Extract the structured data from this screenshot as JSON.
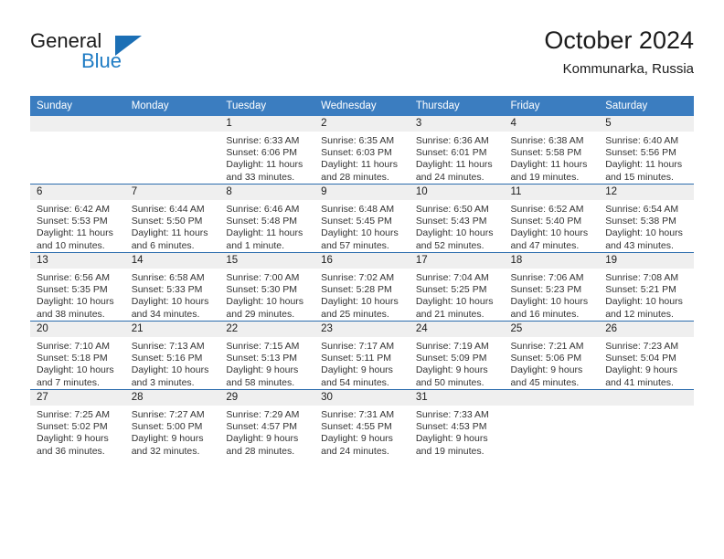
{
  "brand": {
    "name_top": "General",
    "name_bottom": "Blue",
    "triangle_color": "#1b6fb5",
    "blue_text_color": "#1f7cc4"
  },
  "header": {
    "title": "October 2024",
    "subtitle": "Kommunarka, Russia"
  },
  "colors": {
    "header_blue": "#3b7dc0",
    "row_divider": "#2b6cad",
    "daynum_band": "#efefef",
    "text": "#1b1b1b"
  },
  "calendar": {
    "weekday_headers": [
      "Sunday",
      "Monday",
      "Tuesday",
      "Wednesday",
      "Thursday",
      "Friday",
      "Saturday"
    ],
    "labels": {
      "sunrise": "Sunrise:",
      "sunset": "Sunset:",
      "daylight": "Daylight:"
    },
    "weeks": [
      [
        {
          "day": "",
          "empty": true
        },
        {
          "day": "",
          "empty": true
        },
        {
          "day": "1",
          "sunrise": "Sunrise: 6:33 AM",
          "sunset": "Sunset: 6:06 PM",
          "daylight": "Daylight: 11 hours and 33 minutes."
        },
        {
          "day": "2",
          "sunrise": "Sunrise: 6:35 AM",
          "sunset": "Sunset: 6:03 PM",
          "daylight": "Daylight: 11 hours and 28 minutes."
        },
        {
          "day": "3",
          "sunrise": "Sunrise: 6:36 AM",
          "sunset": "Sunset: 6:01 PM",
          "daylight": "Daylight: 11 hours and 24 minutes."
        },
        {
          "day": "4",
          "sunrise": "Sunrise: 6:38 AM",
          "sunset": "Sunset: 5:58 PM",
          "daylight": "Daylight: 11 hours and 19 minutes."
        },
        {
          "day": "5",
          "sunrise": "Sunrise: 6:40 AM",
          "sunset": "Sunset: 5:56 PM",
          "daylight": "Daylight: 11 hours and 15 minutes."
        }
      ],
      [
        {
          "day": "6",
          "sunrise": "Sunrise: 6:42 AM",
          "sunset": "Sunset: 5:53 PM",
          "daylight": "Daylight: 11 hours and 10 minutes."
        },
        {
          "day": "7",
          "sunrise": "Sunrise: 6:44 AM",
          "sunset": "Sunset: 5:50 PM",
          "daylight": "Daylight: 11 hours and 6 minutes."
        },
        {
          "day": "8",
          "sunrise": "Sunrise: 6:46 AM",
          "sunset": "Sunset: 5:48 PM",
          "daylight": "Daylight: 11 hours and 1 minute."
        },
        {
          "day": "9",
          "sunrise": "Sunrise: 6:48 AM",
          "sunset": "Sunset: 5:45 PM",
          "daylight": "Daylight: 10 hours and 57 minutes."
        },
        {
          "day": "10",
          "sunrise": "Sunrise: 6:50 AM",
          "sunset": "Sunset: 5:43 PM",
          "daylight": "Daylight: 10 hours and 52 minutes."
        },
        {
          "day": "11",
          "sunrise": "Sunrise: 6:52 AM",
          "sunset": "Sunset: 5:40 PM",
          "daylight": "Daylight: 10 hours and 47 minutes."
        },
        {
          "day": "12",
          "sunrise": "Sunrise: 6:54 AM",
          "sunset": "Sunset: 5:38 PM",
          "daylight": "Daylight: 10 hours and 43 minutes."
        }
      ],
      [
        {
          "day": "13",
          "sunrise": "Sunrise: 6:56 AM",
          "sunset": "Sunset: 5:35 PM",
          "daylight": "Daylight: 10 hours and 38 minutes."
        },
        {
          "day": "14",
          "sunrise": "Sunrise: 6:58 AM",
          "sunset": "Sunset: 5:33 PM",
          "daylight": "Daylight: 10 hours and 34 minutes."
        },
        {
          "day": "15",
          "sunrise": "Sunrise: 7:00 AM",
          "sunset": "Sunset: 5:30 PM",
          "daylight": "Daylight: 10 hours and 29 minutes."
        },
        {
          "day": "16",
          "sunrise": "Sunrise: 7:02 AM",
          "sunset": "Sunset: 5:28 PM",
          "daylight": "Daylight: 10 hours and 25 minutes."
        },
        {
          "day": "17",
          "sunrise": "Sunrise: 7:04 AM",
          "sunset": "Sunset: 5:25 PM",
          "daylight": "Daylight: 10 hours and 21 minutes."
        },
        {
          "day": "18",
          "sunrise": "Sunrise: 7:06 AM",
          "sunset": "Sunset: 5:23 PM",
          "daylight": "Daylight: 10 hours and 16 minutes."
        },
        {
          "day": "19",
          "sunrise": "Sunrise: 7:08 AM",
          "sunset": "Sunset: 5:21 PM",
          "daylight": "Daylight: 10 hours and 12 minutes."
        }
      ],
      [
        {
          "day": "20",
          "sunrise": "Sunrise: 7:10 AM",
          "sunset": "Sunset: 5:18 PM",
          "daylight": "Daylight: 10 hours and 7 minutes."
        },
        {
          "day": "21",
          "sunrise": "Sunrise: 7:13 AM",
          "sunset": "Sunset: 5:16 PM",
          "daylight": "Daylight: 10 hours and 3 minutes."
        },
        {
          "day": "22",
          "sunrise": "Sunrise: 7:15 AM",
          "sunset": "Sunset: 5:13 PM",
          "daylight": "Daylight: 9 hours and 58 minutes."
        },
        {
          "day": "23",
          "sunrise": "Sunrise: 7:17 AM",
          "sunset": "Sunset: 5:11 PM",
          "daylight": "Daylight: 9 hours and 54 minutes."
        },
        {
          "day": "24",
          "sunrise": "Sunrise: 7:19 AM",
          "sunset": "Sunset: 5:09 PM",
          "daylight": "Daylight: 9 hours and 50 minutes."
        },
        {
          "day": "25",
          "sunrise": "Sunrise: 7:21 AM",
          "sunset": "Sunset: 5:06 PM",
          "daylight": "Daylight: 9 hours and 45 minutes."
        },
        {
          "day": "26",
          "sunrise": "Sunrise: 7:23 AM",
          "sunset": "Sunset: 5:04 PM",
          "daylight": "Daylight: 9 hours and 41 minutes."
        }
      ],
      [
        {
          "day": "27",
          "sunrise": "Sunrise: 7:25 AM",
          "sunset": "Sunset: 5:02 PM",
          "daylight": "Daylight: 9 hours and 36 minutes."
        },
        {
          "day": "28",
          "sunrise": "Sunrise: 7:27 AM",
          "sunset": "Sunset: 5:00 PM",
          "daylight": "Daylight: 9 hours and 32 minutes."
        },
        {
          "day": "29",
          "sunrise": "Sunrise: 7:29 AM",
          "sunset": "Sunset: 4:57 PM",
          "daylight": "Daylight: 9 hours and 28 minutes."
        },
        {
          "day": "30",
          "sunrise": "Sunrise: 7:31 AM",
          "sunset": "Sunset: 4:55 PM",
          "daylight": "Daylight: 9 hours and 24 minutes."
        },
        {
          "day": "31",
          "sunrise": "Sunrise: 7:33 AM",
          "sunset": "Sunset: 4:53 PM",
          "daylight": "Daylight: 9 hours and 19 minutes."
        },
        {
          "day": "",
          "empty": true
        },
        {
          "day": "",
          "empty": true
        }
      ]
    ]
  }
}
